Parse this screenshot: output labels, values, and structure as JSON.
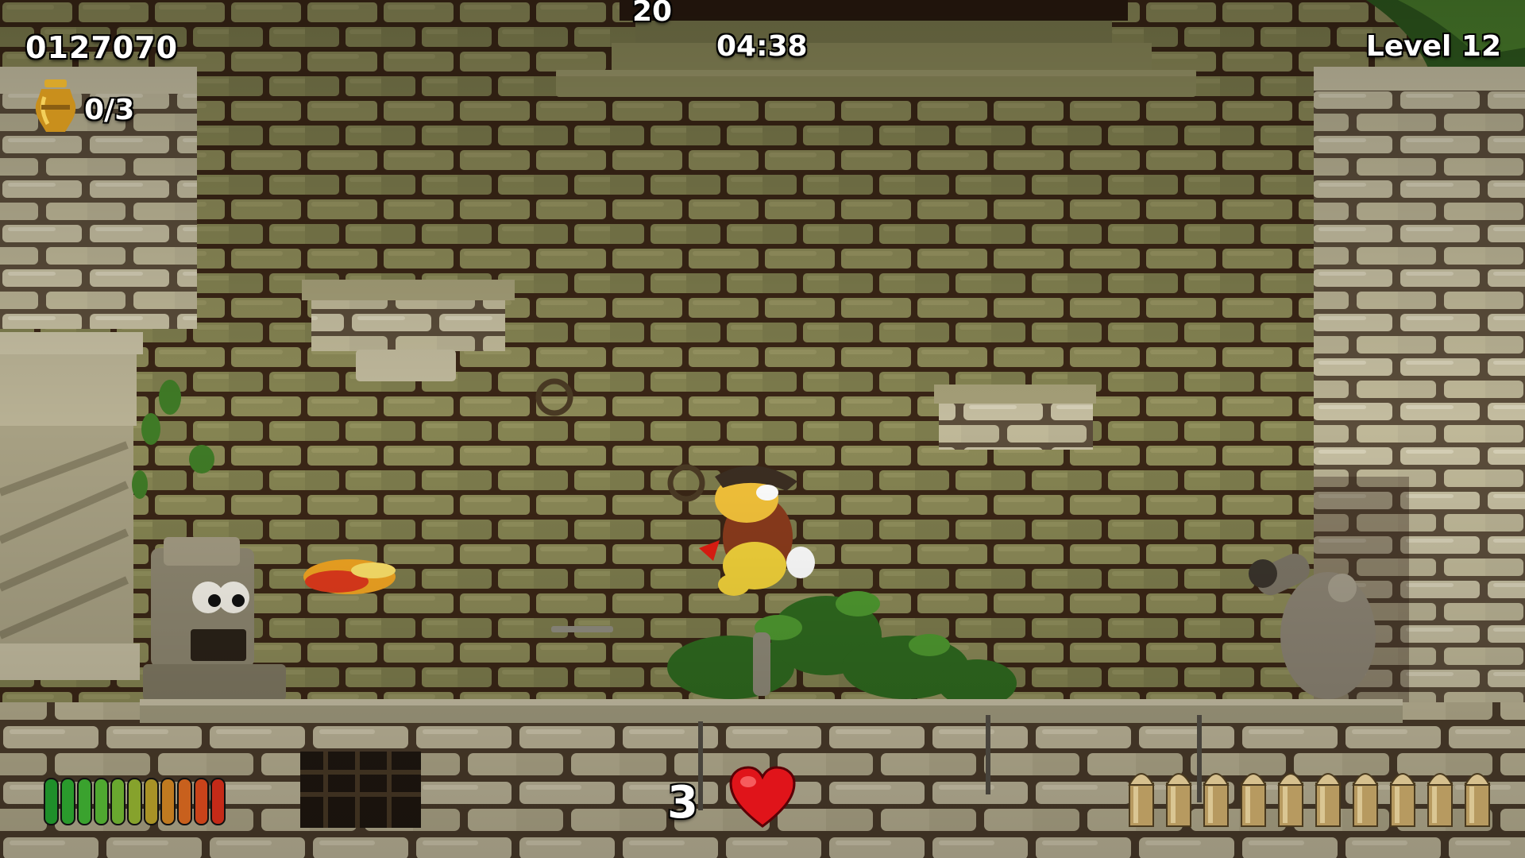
{
  "hud": {
    "score": "0127070",
    "combo": "20",
    "timer": "04:38",
    "level": "Level 12",
    "collectibles": "0/3",
    "lives": "3"
  },
  "health": {
    "segments_total": 11,
    "segments_filled": 11,
    "colors": [
      "#1f8f2a",
      "#2a9a2c",
      "#3aa22e",
      "#4fa830",
      "#69a82f",
      "#86a22c",
      "#a89226",
      "#c07a20",
      "#c8601d",
      "#c8431a",
      "#c42a18"
    ]
  },
  "ammo": {
    "bullets": 10
  },
  "icons": {
    "collectible": "golden-urn-icon",
    "lives": "heart-icon",
    "ammo": "bullet-icon"
  },
  "colors": {
    "mortar": "#3a2616",
    "stone": "#8d8a58",
    "stone_light": "#c7c0a4",
    "heart": "#e0141a"
  }
}
